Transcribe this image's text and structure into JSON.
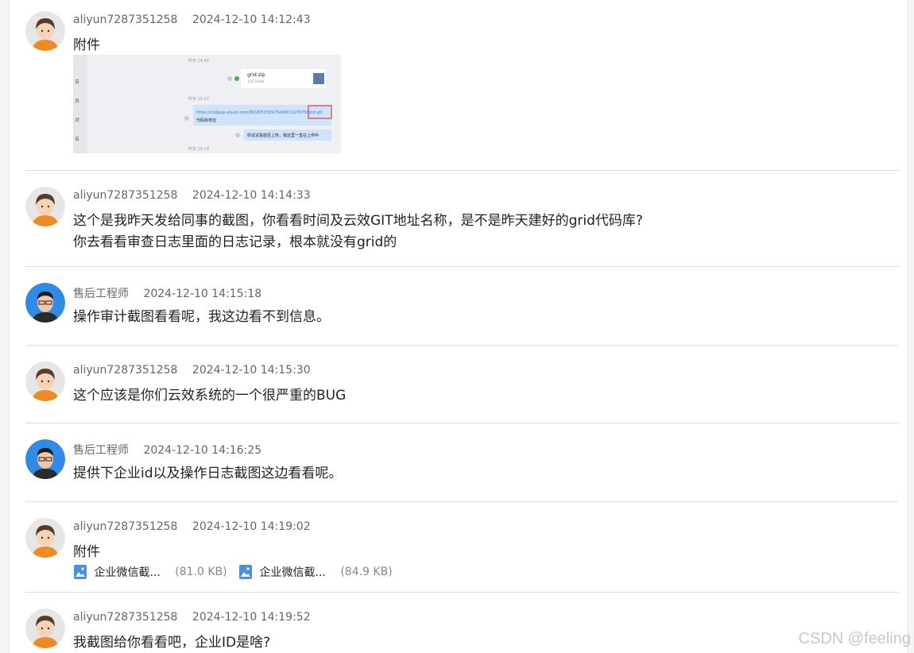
{
  "messages": [
    {
      "user": "aliyun7287351258",
      "time": "2024-12-10 14:12:43",
      "text": "附件",
      "avatar": "female-avatar"
    },
    {
      "user": "aliyun7287351258",
      "time": "2024-12-10 14:14:33",
      "lines": [
        "这个是我昨天发给同事的截图，你看看时间及云效GIT地址名称，是不是昨天建好的grid代码库?",
        "你去看看审查日志里面的日志记录，根本就没有grid的"
      ],
      "avatar": "female-avatar"
    },
    {
      "user": "售后工程师",
      "time": "2024-12-10 14:15:18",
      "text": "操作审计截图看看呢，我这边看不到信息。",
      "avatar": "engineer-avatar"
    },
    {
      "user": "aliyun7287351258",
      "time": "2024-12-10 14:15:30",
      "text": "这个应该是你们云效系统的一个很严重的BUG",
      "avatar": "female-avatar"
    },
    {
      "user": "售后工程师",
      "time": "2024-12-10 14:16:25",
      "text": "提供下企业id以及操作日志截图这边看看呢。",
      "avatar": "engineer-avatar"
    },
    {
      "user": "aliyun7287351258",
      "time": "2024-12-10 14:19:02",
      "text": "附件",
      "avatar": "female-avatar",
      "files": [
        {
          "name": "企业微信截...",
          "size": "(81.0 KB)"
        },
        {
          "name": "企业微信截...",
          "size": "(84.9 KB)"
        }
      ]
    },
    {
      "user": "aliyun7287351258",
      "time": "2024-12-10 14:19:52",
      "text": "我截图给你看看吧，企业ID是啥?",
      "avatar": "female-avatar"
    }
  ],
  "attachment_preview": {
    "time1": "昨天 14:45",
    "file_name": "grid.zip",
    "file_size": "122.83kB",
    "time2": "昨天 15:17",
    "link": "https://codeup.aliyun.com/6018f31f1fb75e0001127076/grid.git",
    "link_caption": "代码库地址",
    "reply": "你试试看能否上传，我这里一直在上传中",
    "time3": "昨天 15:18",
    "side_labels": [
      "告",
      "员",
      "对",
      "告"
    ]
  },
  "watermark": "CSDN @feeling",
  "colors": {
    "accent": "#4a90e2",
    "highlight": "#e02020"
  }
}
